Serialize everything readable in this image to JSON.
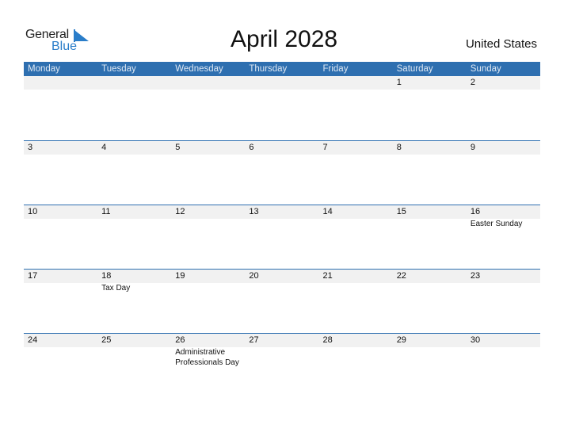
{
  "logo": {
    "general": "General",
    "blue": "Blue"
  },
  "title": "April 2028",
  "country": "United States",
  "colors": {
    "header_bg": "#2e6fb0",
    "accent": "#2a7dc9",
    "date_band": "#f1f1f1"
  },
  "weekdays": [
    "Monday",
    "Tuesday",
    "Wednesday",
    "Thursday",
    "Friday",
    "Saturday",
    "Sunday"
  ],
  "weeks": [
    [
      {
        "d": ""
      },
      {
        "d": ""
      },
      {
        "d": ""
      },
      {
        "d": ""
      },
      {
        "d": ""
      },
      {
        "d": "1"
      },
      {
        "d": "2"
      }
    ],
    [
      {
        "d": "3"
      },
      {
        "d": "4"
      },
      {
        "d": "5"
      },
      {
        "d": "6"
      },
      {
        "d": "7"
      },
      {
        "d": "8"
      },
      {
        "d": "9"
      }
    ],
    [
      {
        "d": "10"
      },
      {
        "d": "11"
      },
      {
        "d": "12"
      },
      {
        "d": "13"
      },
      {
        "d": "14"
      },
      {
        "d": "15"
      },
      {
        "d": "16",
        "h": "Easter Sunday"
      }
    ],
    [
      {
        "d": "17"
      },
      {
        "d": "18",
        "h": "Tax Day"
      },
      {
        "d": "19"
      },
      {
        "d": "20"
      },
      {
        "d": "21"
      },
      {
        "d": "22"
      },
      {
        "d": "23"
      }
    ],
    [
      {
        "d": "24"
      },
      {
        "d": "25"
      },
      {
        "d": "26",
        "h": "Administrative Professionals Day"
      },
      {
        "d": "27"
      },
      {
        "d": "28"
      },
      {
        "d": "29"
      },
      {
        "d": "30"
      }
    ]
  ]
}
